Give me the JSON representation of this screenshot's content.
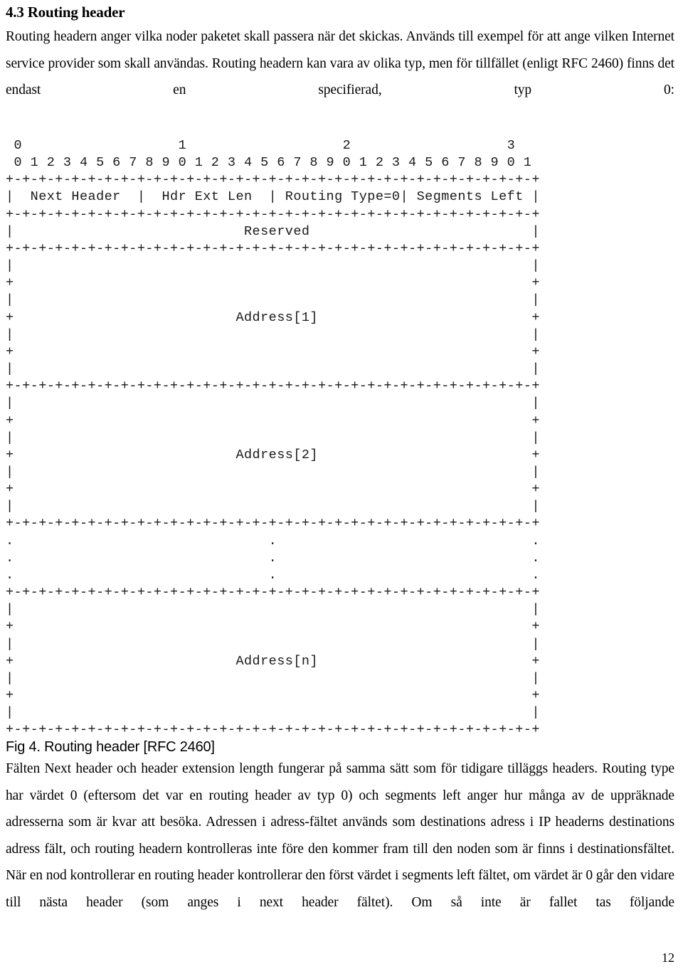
{
  "document": {
    "language": "sv",
    "page_number": "12"
  },
  "section": {
    "heading": "4.3 Routing header",
    "intro_paragraph": "Routing headern anger vilka noder paketet skall passera när det skickas. Används till exempel för att ange vilken Internet service provider som skall användas. Routing headern kan vara av olika typ, men för tillfället (enligt RFC 2460) finns det endast en specifierad, typ 0:"
  },
  "figure": {
    "caption": "Fig 4. Routing header [RFC 2460]",
    "ascii_lines": [
      " 0                   1                   2                   3",
      " 0 1 2 3 4 5 6 7 8 9 0 1 2 3 4 5 6 7 8 9 0 1 2 3 4 5 6 7 8 9 0 1",
      "+-+-+-+-+-+-+-+-+-+-+-+-+-+-+-+-+-+-+-+-+-+-+-+-+-+-+-+-+-+-+-+-+",
      "|  Next Header  |  Hdr Ext Len  | Routing Type=0| Segments Left |",
      "+-+-+-+-+-+-+-+-+-+-+-+-+-+-+-+-+-+-+-+-+-+-+-+-+-+-+-+-+-+-+-+-+",
      "|                            Reserved                           |",
      "+-+-+-+-+-+-+-+-+-+-+-+-+-+-+-+-+-+-+-+-+-+-+-+-+-+-+-+-+-+-+-+-+",
      "|                                                               |",
      "+                                                               +",
      "|                                                               |",
      "+                           Address[1]                          +",
      "|                                                               |",
      "+                                                               +",
      "|                                                               |",
      "+-+-+-+-+-+-+-+-+-+-+-+-+-+-+-+-+-+-+-+-+-+-+-+-+-+-+-+-+-+-+-+-+",
      "|                                                               |",
      "+                                                               +",
      "|                                                               |",
      "+                           Address[2]                          +",
      "|                                                               |",
      "+                                                               +",
      "|                                                               |",
      "+-+-+-+-+-+-+-+-+-+-+-+-+-+-+-+-+-+-+-+-+-+-+-+-+-+-+-+-+-+-+-+-+",
      ".                               .                               .",
      ".                               .                               .",
      ".                               .                               .",
      "+-+-+-+-+-+-+-+-+-+-+-+-+-+-+-+-+-+-+-+-+-+-+-+-+-+-+-+-+-+-+-+-+",
      "|                                                               |",
      "+                                                               +",
      "|                                                               |",
      "+                           Address[n]                          +",
      "|                                                               |",
      "+                                                               +",
      "|                                                               |",
      "+-+-+-+-+-+-+-+-+-+-+-+-+-+-+-+-+-+-+-+-+-+-+-+-+-+-+-+-+-+-+-+-+"
    ],
    "fields": [
      "Next Header",
      "Hdr Ext Len",
      "Routing Type=0",
      "Segments Left",
      "Reserved",
      "Address[1]",
      "Address[2]",
      "Address[n]"
    ],
    "bit_ruler_decades": [
      "0",
      "1",
      "2",
      "3"
    ],
    "bit_ruler_units": "0 1 2 3 4 5 6 7 8 9 0 1 2 3 4 5 6 7 8 9 0 1 2 3 4 5 6 7 8 9 0 1"
  },
  "body": {
    "paragraph_1": "Fälten Next header och header extension length fungerar på samma sätt som för tidigare tilläggs headers. Routing type har värdet 0 (eftersom det var en routing header av typ 0) och segments left anger hur många av de uppräknade adresserna som är kvar att besöka. Adressen i adress-fältet används som destinations adress i IP headerns destinations adress fält, och routing headern kontrolleras inte före den kommer fram till den noden som är finns i destinationsfältet. När en nod kontrollerar en routing header kontrollerar den först värdet i segments left fältet, om värdet är 0 går den vidare till nästa header (som anges i next header fältet). Om så inte är fallet tas följande"
  }
}
